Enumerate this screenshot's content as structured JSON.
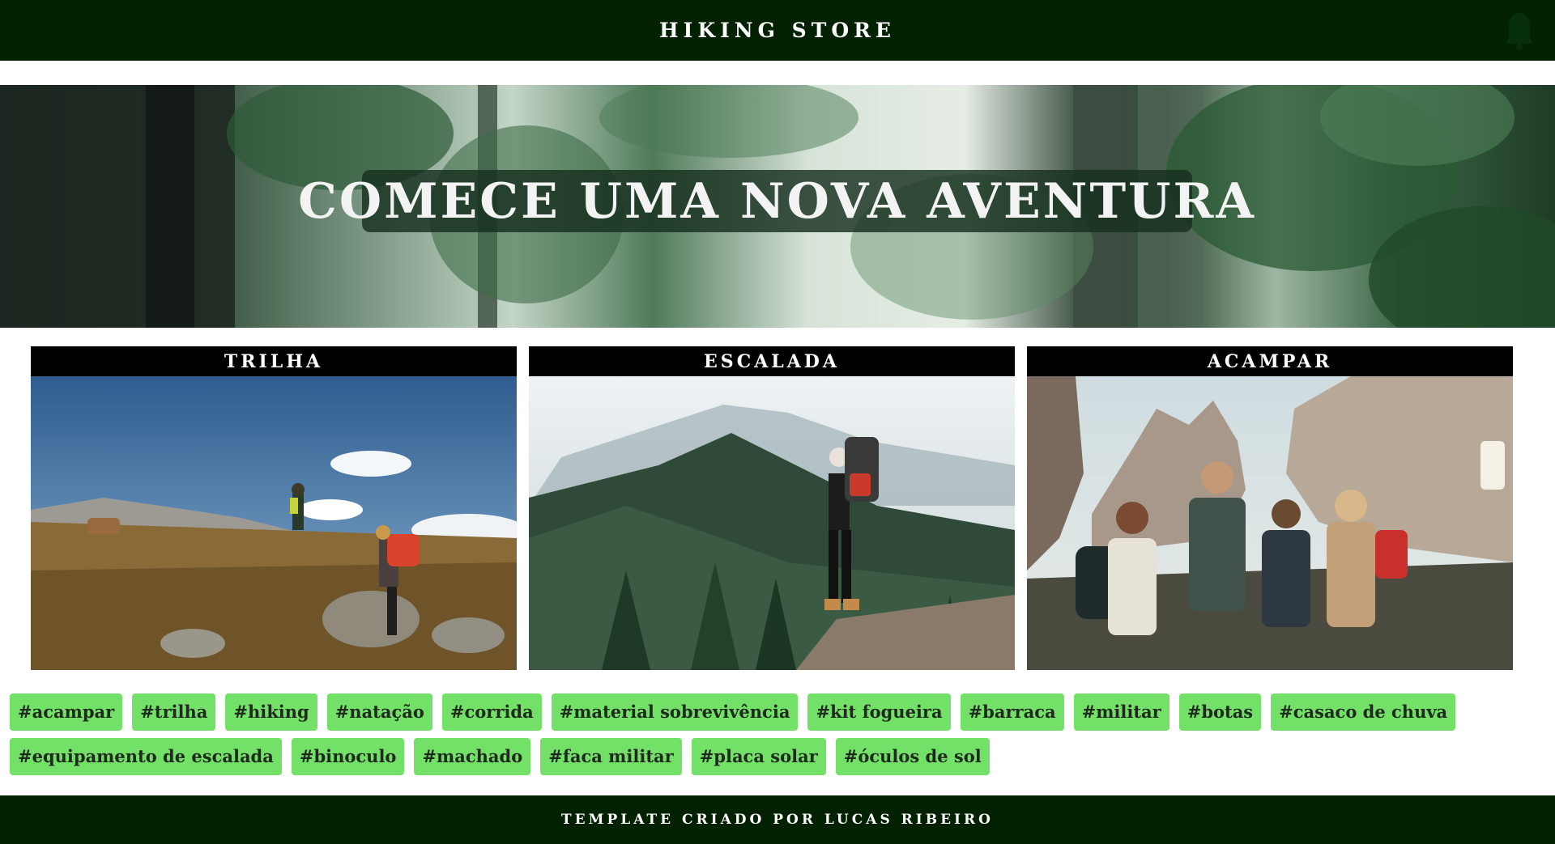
{
  "header": {
    "title": "HIKING STORE",
    "icon": "bell-icon"
  },
  "hero": {
    "title": "COMECE UMA NOVA AVENTURA"
  },
  "cards": [
    {
      "title": "TRILHA"
    },
    {
      "title": "ESCALADA"
    },
    {
      "title": "ACAMPAR"
    }
  ],
  "tags": {
    "row1": [
      "#acampar",
      "#trilha",
      "#hiking",
      "#natação",
      "#corrida",
      "#material sobrevivência",
      "#kit fogueira",
      "#barraca",
      "#militar",
      "#botas",
      "#casaco de chuva"
    ],
    "row2": [
      "#equipamento de escalada",
      "#binoculo",
      "#machado",
      "#faca militar",
      "#placa solar",
      "#óculos de sol"
    ]
  },
  "footer": {
    "text": "TEMPLATE CRIADO POR LUCAS RIBEIRO"
  },
  "colors": {
    "header_bg": "#022100",
    "tag_bg": "#73e068",
    "card_header_bg": "#000000"
  }
}
